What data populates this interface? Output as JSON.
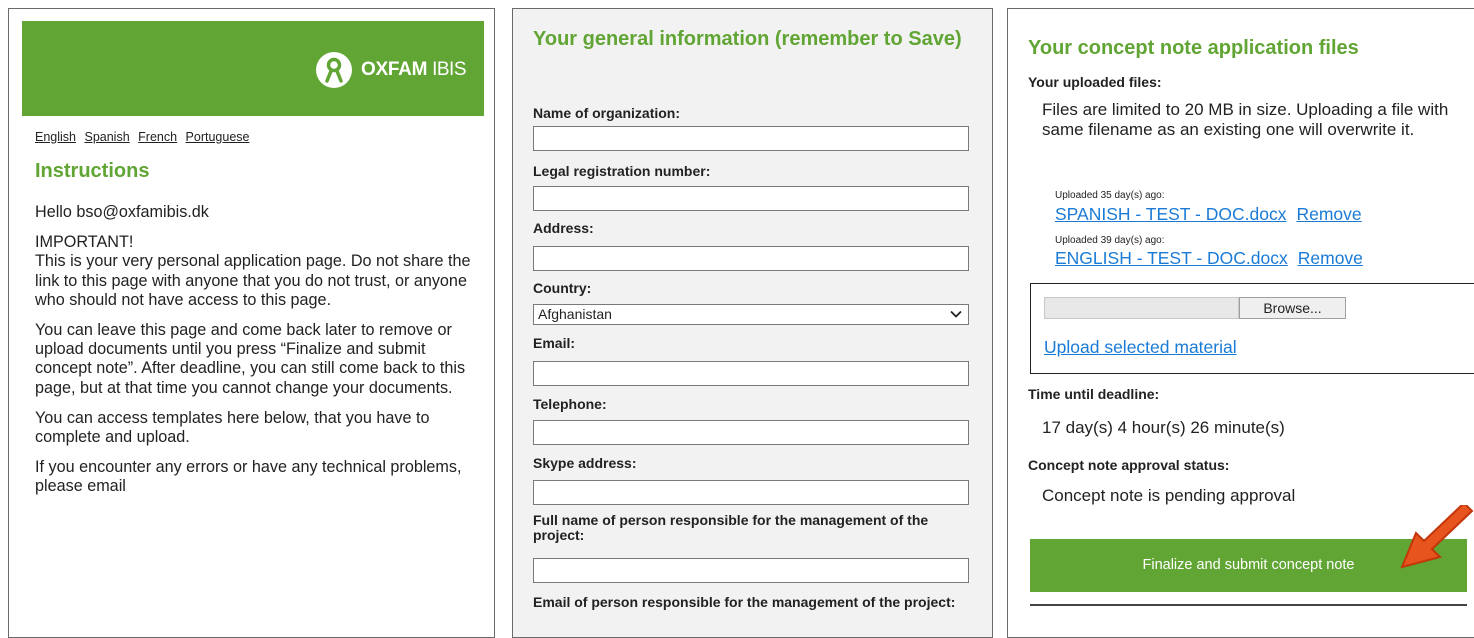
{
  "left": {
    "logo_bold": "OXFAM",
    "logo_light": "IBIS",
    "languages": [
      "English",
      "Spanish",
      "French",
      "Portuguese"
    ],
    "instructions_title": "Instructions",
    "greeting": "Hello bso@oxfamibis.dk",
    "important_title": "IMPORTANT!",
    "important_text": "This is your very personal application page. Do not share the link to this page with anyone that you do not trust, or anyone who should not have access to this page.",
    "para2": "You can leave this page and come back later to remove or upload documents until you press “Finalize and submit concept note”. After deadline, you can still come back to this page, but at that time you cannot change your documents.",
    "para3": "You can access templates here below, that you have to complete and upload.",
    "para4": "If you encounter any errors or have any technical problems, please email"
  },
  "middle": {
    "title": "Your general information (remember to Save)",
    "fields": {
      "org": "Name of organization:",
      "legal": "Legal registration number:",
      "address": "Address:",
      "country": "Country:",
      "country_value": "Afghanistan",
      "email": "Email:",
      "telephone": "Telephone:",
      "skype": "Skype address:",
      "fullname": "Full name of person responsible for the management of the project:",
      "email_resp": "Email of person responsible for the management of the project:"
    }
  },
  "right": {
    "title": "Your concept note application files",
    "uploaded_label": "Your uploaded files:",
    "size_note": "Files are limited to 20 MB in size. Uploading a file with same filename as an existing one will overwrite it.",
    "files": [
      {
        "age": "Uploaded 35 day(s) ago:",
        "name": "SPANISH - TEST - DOC.docx",
        "remove": "Remove"
      },
      {
        "age": "Uploaded 39 day(s) ago:",
        "name": "ENGLISH - TEST - DOC.docx",
        "remove": "Remove"
      }
    ],
    "browse_label": "Browse...",
    "upload_link": "Upload selected material",
    "deadline_label": "Time until deadline:",
    "deadline_value": "17 day(s) 4 hour(s) 26 minute(s)",
    "status_label": "Concept note approval status:",
    "status_value": "Concept note is pending approval",
    "submit_label": "Finalize and submit concept note"
  },
  "colors": {
    "green": "#61a534",
    "link": "#1a7bd6",
    "arrow": "#e8541d"
  }
}
